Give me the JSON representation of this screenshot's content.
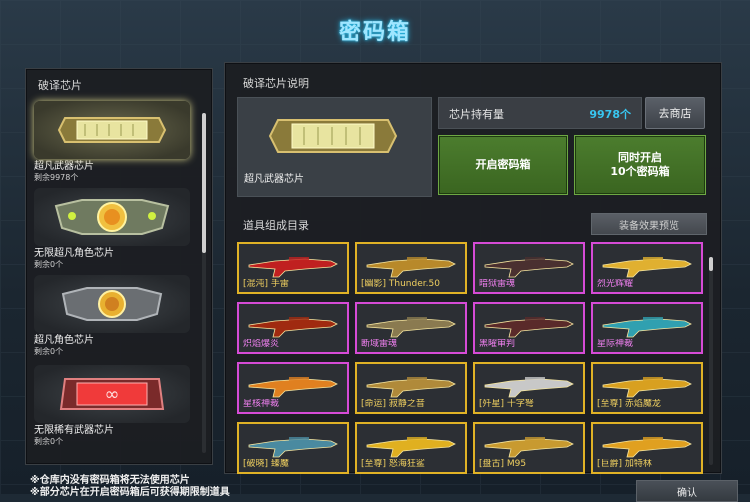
{
  "title": "密码箱",
  "left_panel": {
    "heading": "破译芯片",
    "chips": [
      {
        "name": "超凡武器芯片",
        "count": "剩余9978个",
        "selected": true
      },
      {
        "name": "无限超凡角色芯片",
        "count": "剩余0个",
        "selected": false
      },
      {
        "name": "超凡角色芯片",
        "count": "剩余0个",
        "selected": false
      },
      {
        "name": "无限稀有武器芯片",
        "count": "剩余0个",
        "selected": false
      }
    ]
  },
  "right_panel": {
    "description_heading": "破译芯片说明",
    "selected_chip_name": "超凡武器芯片",
    "hold_label": "芯片持有量",
    "hold_value": "9978个",
    "shop_button": "去商店",
    "open_button": "开启密码箱",
    "open10_button_line1": "同时开启",
    "open10_button_line2": "10个密码箱",
    "catalog_heading": "道具组成目录",
    "preview_button": "装备效果预览",
    "items": [
      {
        "label": "[混沌] 手雷",
        "rarity": "gold",
        "color": "#c02020"
      },
      {
        "label": "[幽影] Thunder.50",
        "rarity": "gold",
        "color": "#b8892a"
      },
      {
        "label": "暗狱雷魂",
        "rarity": "pink",
        "color": "#4a3030"
      },
      {
        "label": "烈光辉耀",
        "rarity": "pink",
        "color": "#e0b030"
      },
      {
        "label": "炽焰爆炎",
        "rarity": "pink",
        "color": "#a02a10"
      },
      {
        "label": "断域雷魂",
        "rarity": "pink",
        "color": "#8a7a50"
      },
      {
        "label": "黑曜审判",
        "rarity": "pink",
        "color": "#5a2a2a"
      },
      {
        "label": "星际神裁",
        "rarity": "pink",
        "color": "#30a0b0"
      },
      {
        "label": "星核神裁",
        "rarity": "pink",
        "color": "#e08020"
      },
      {
        "label": "[命运] 寂静之音",
        "rarity": "gold",
        "color": "#b08a3a"
      },
      {
        "label": "[歼星] 十字弩",
        "rarity": "gold",
        "color": "#c8c8c8"
      },
      {
        "label": "[至尊] 赤焰魔龙",
        "rarity": "gold",
        "color": "#d8a020"
      },
      {
        "label": "[破晓] 臻魔",
        "rarity": "gold",
        "color": "#4a8aa0"
      },
      {
        "label": "[至尊] 怒海狂鲨",
        "rarity": "gold",
        "color": "#e0b020"
      },
      {
        "label": "[盘古] M95",
        "rarity": "gold",
        "color": "#c89a30"
      },
      {
        "label": "[巨爵] 加特林",
        "rarity": "gold",
        "color": "#e0a020"
      }
    ]
  },
  "footer_line1": "※仓库内没有密码箱将无法使用芯片",
  "footer_line2": "※部分芯片在开启密码箱后可获得期限制道具",
  "confirm_button": "确认"
}
